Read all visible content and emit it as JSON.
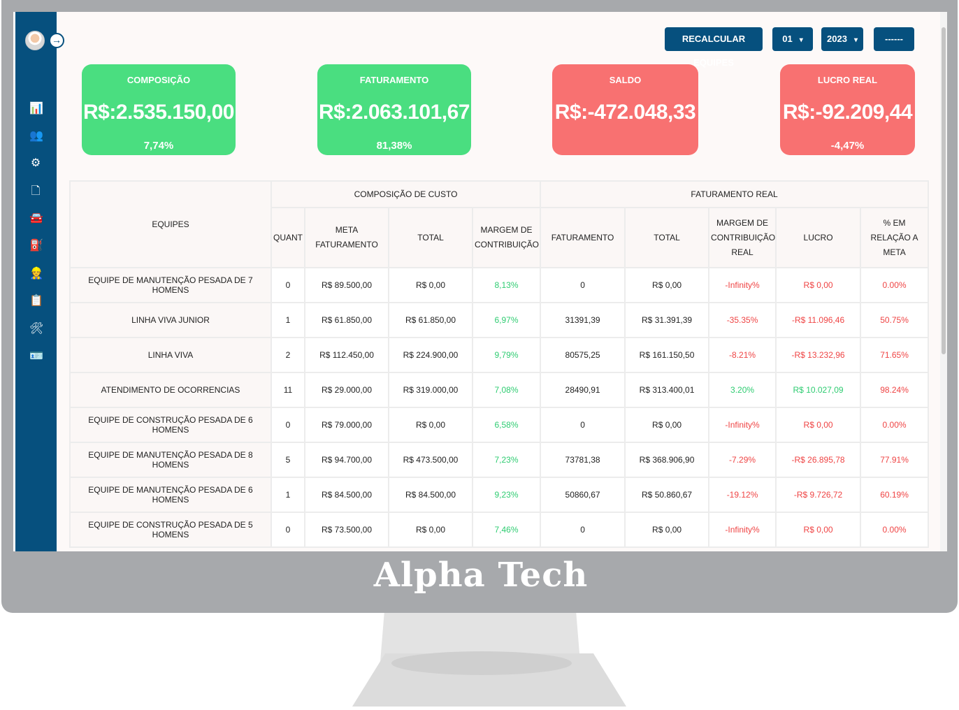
{
  "brand": "Alpha Tech",
  "sidebar": {
    "items": [
      {
        "name": "dashboard",
        "icon": "bar-chart-icon",
        "glyph": "📊"
      },
      {
        "name": "users",
        "icon": "users-icon",
        "glyph": "👥"
      },
      {
        "name": "settings",
        "icon": "gear-icon",
        "glyph": "⚙"
      },
      {
        "name": "documents",
        "icon": "file-plus-icon",
        "glyph": "🗋"
      },
      {
        "name": "vehicles",
        "icon": "car-icon",
        "glyph": "🚘"
      },
      {
        "name": "fuel",
        "icon": "fuel-pump-icon",
        "glyph": "⛽"
      },
      {
        "name": "workers",
        "icon": "worker-icon",
        "glyph": "👷"
      },
      {
        "name": "reports",
        "icon": "report-icon",
        "glyph": "📋"
      },
      {
        "name": "equipment",
        "icon": "tools-icon",
        "glyph": "🛠"
      },
      {
        "name": "contacts",
        "icon": "id-card-icon",
        "glyph": "🪪"
      }
    ]
  },
  "toolbar": {
    "recalc_label": "RECALCULAR EQUIPES",
    "month_value": "01",
    "year_value": "2023",
    "extra_label": "------"
  },
  "cards": [
    {
      "title": "COMPOSIÇÃO",
      "value": "R$:2.535.150,00",
      "percent": "7,74%",
      "status": "green"
    },
    {
      "title": "FATURAMENTO",
      "value": "R$:2.063.101,67",
      "percent": "81,38%",
      "status": "green"
    },
    {
      "title": "SALDO",
      "value": "R$:-472.048,33",
      "percent": "",
      "status": "red"
    },
    {
      "title": "LUCRO REAL",
      "value": "R$:-92.209,44",
      "percent": "-4,47%",
      "status": "red"
    }
  ],
  "colors": {
    "green": "#4ade80",
    "red": "#f87171",
    "sidebar": "#06507e",
    "positive_text": "#2ecc71",
    "negative_text": "#ef4444"
  },
  "table": {
    "group_headers": {
      "equipes": "EQUIPES",
      "composicao": "COMPOSIÇÃO DE CUSTO",
      "faturamento": "FATURAMENTO REAL"
    },
    "columns": [
      "QUANT",
      "META FATURAMENTO",
      "TOTAL",
      "MARGEM DE CONTRIBUIÇÃO",
      "FATURAMENTO",
      "TOTAL",
      "MARGEM DE CONTRIBUIÇÃO REAL",
      "LUCRO",
      "% EM RELAÇÃO A META"
    ],
    "rows": [
      [
        "EQUIPE DE MANUTENÇÃO PESADA DE 7 HOMENS",
        "0",
        "R$ 89.500,00",
        "R$ 0,00",
        "8,13%",
        "0",
        "R$ 0,00",
        "-Infinity%",
        "R$ 0,00",
        "0.00%"
      ],
      [
        "LINHA VIVA JUNIOR",
        "1",
        "R$ 61.850,00",
        "R$ 61.850,00",
        "6,97%",
        "31391,39",
        "R$ 31.391,39",
        "-35.35%",
        "-R$ 11.096,46",
        "50.75%"
      ],
      [
        "LINHA VIVA",
        "2",
        "R$ 112.450,00",
        "R$ 224.900,00",
        "9,79%",
        "80575,25",
        "R$ 161.150,50",
        "-8.21%",
        "-R$ 13.232,96",
        "71.65%"
      ],
      [
        "ATENDIMENTO DE OCORRENCIAS",
        "11",
        "R$ 29.000,00",
        "R$ 319.000,00",
        "7,08%",
        "28490,91",
        "R$ 313.400,01",
        "3.20%",
        "R$ 10.027,09",
        "98.24%"
      ],
      [
        "EQUIPE DE CONSTRUÇÃO PESADA DE 6 HOMENS",
        "0",
        "R$ 79.000,00",
        "R$ 0,00",
        "6,58%",
        "0",
        "R$ 0,00",
        "-Infinity%",
        "R$ 0,00",
        "0.00%"
      ],
      [
        "EQUIPE DE MANUTENÇÃO PESADA DE 8 HOMENS",
        "5",
        "R$ 94.700,00",
        "R$ 473.500,00",
        "7,23%",
        "73781,38",
        "R$ 368.906,90",
        "-7.29%",
        "-R$ 26.895,78",
        "77.91%"
      ],
      [
        "EQUIPE DE MANUTENÇÃO PESADA DE 6 HOMENS",
        "1",
        "R$ 84.500,00",
        "R$ 84.500,00",
        "9,23%",
        "50860,67",
        "R$ 50.860,67",
        "-19.12%",
        "-R$ 9.726,72",
        "60.19%"
      ],
      [
        "EQUIPE DE CONSTRUÇÃO PESADA DE 5 HOMENS",
        "0",
        "R$ 73.500,00",
        "R$ 0,00",
        "7,46%",
        "0",
        "R$ 0,00",
        "-Infinity%",
        "R$ 0,00",
        "0.00%"
      ]
    ],
    "lucro_status": [
      "red",
      "red",
      "red",
      "green",
      "red",
      "red",
      "red",
      "red"
    ]
  }
}
